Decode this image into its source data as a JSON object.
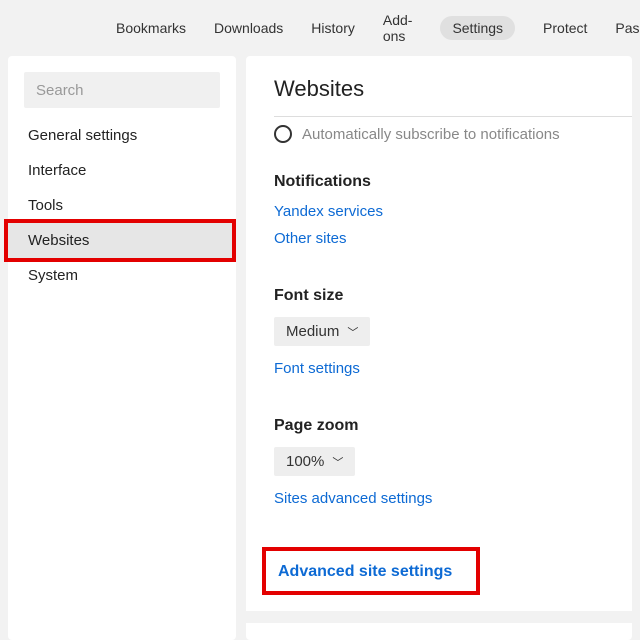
{
  "topnav": {
    "items": [
      "Bookmarks",
      "Downloads",
      "History",
      "Add-ons",
      "Settings",
      "Protect",
      "Password"
    ],
    "active": "Settings"
  },
  "sidebar": {
    "search_placeholder": "Search",
    "items": [
      "General settings",
      "Interface",
      "Tools",
      "Websites",
      "System"
    ],
    "active": "Websites"
  },
  "page": {
    "title": "Websites",
    "radio_partial": "Automatically subscribe to notifications",
    "notifications": {
      "title": "Notifications",
      "yandex_link": "Yandex services",
      "other_link": "Other sites"
    },
    "font": {
      "title": "Font size",
      "value": "Medium",
      "settings_link": "Font settings"
    },
    "zoom": {
      "title": "Page zoom",
      "value": "100%",
      "sites_link": "Sites advanced settings"
    },
    "adv_link": "Advanced site settings"
  }
}
